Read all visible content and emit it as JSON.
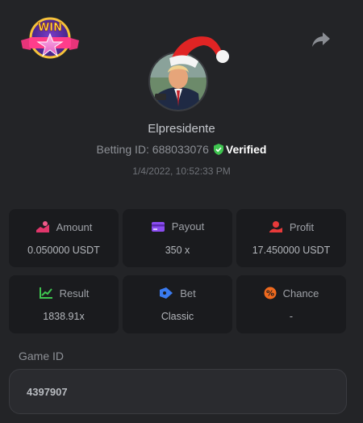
{
  "header": {
    "badge_text": "WIN",
    "share_icon": "share-icon"
  },
  "profile": {
    "username": "Elpresidente",
    "betting_id_label": "Betting ID:",
    "betting_id": "688033076",
    "verified_label": "Verified",
    "timestamp": "1/4/2022, 10:52:33 PM"
  },
  "stats": [
    {
      "label": "Amount",
      "value": "0.050000 USDT",
      "icon": "amount-icon",
      "color": "#e0366b"
    },
    {
      "label": "Payout",
      "value": "350 x",
      "icon": "payout-icon",
      "color": "#8a4cf0"
    },
    {
      "label": "Profit",
      "value": "17.450000 USDT",
      "icon": "profit-icon",
      "color": "#e83a3a"
    },
    {
      "label": "Result",
      "value": "1838.91x",
      "icon": "result-icon",
      "color": "#3ec44f"
    },
    {
      "label": "Bet",
      "value": "Classic",
      "icon": "bet-icon",
      "color": "#3a7bf0"
    },
    {
      "label": "Chance",
      "value": "-",
      "icon": "chance-icon",
      "color": "#f06a1e"
    }
  ],
  "game": {
    "label": "Game ID",
    "id": "4397907"
  },
  "colors": {
    "background": "#232427",
    "card": "#1a1b1e",
    "verified": "#3ec44f"
  }
}
